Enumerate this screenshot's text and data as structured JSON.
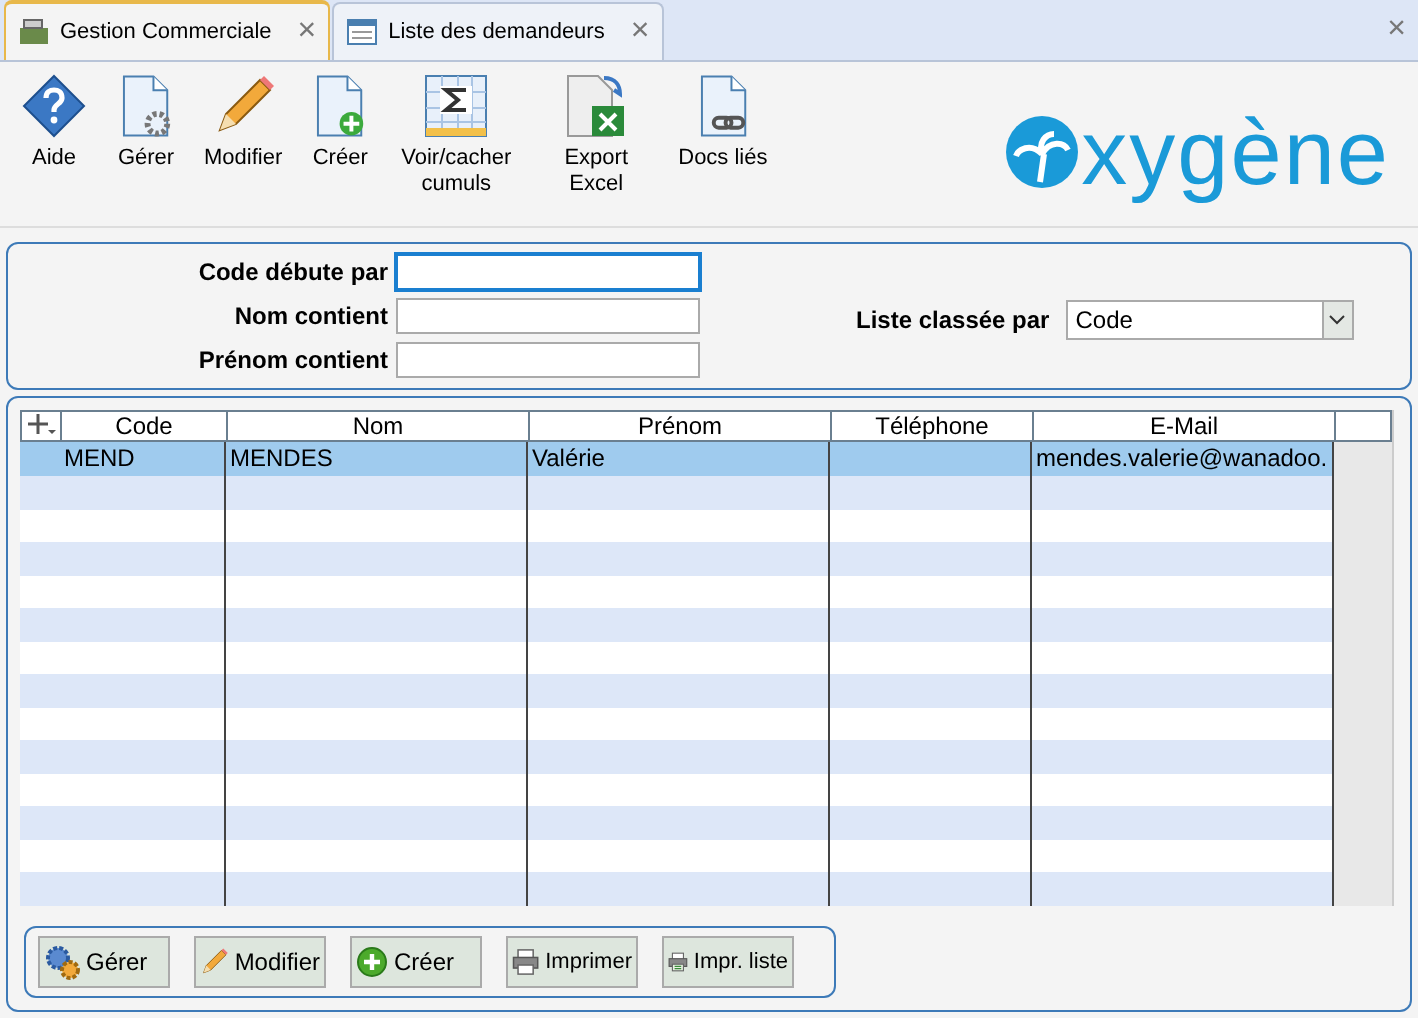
{
  "tabs": [
    {
      "label": "Gestion Commerciale",
      "selected": true,
      "close": "×"
    },
    {
      "label": "Liste des demandeurs",
      "selected": false,
      "close": "×"
    }
  ],
  "close_all": "×",
  "toolbar": [
    "Aide",
    "Gérer",
    "Modifier",
    "Créer",
    "Voir/cacher cumuls",
    "Export Excel",
    "Docs liés"
  ],
  "logo": "xygène",
  "filters": [
    {
      "label": "Code débute par",
      "focused": true
    },
    {
      "label": "Nom contient",
      "focused": false
    },
    {
      "label": "Prénom contient",
      "focused": false
    }
  ],
  "sort": {
    "label": "Liste classée par",
    "value": "Code"
  },
  "table": {
    "columns": [
      "Code",
      "Nom",
      "Prénom",
      "Téléphone",
      "E-Mail"
    ],
    "rows": [
      {
        "cells": [
          "MEND",
          "MENDES",
          "Valérie",
          "",
          "mendes.valerie@wanadoo."
        ],
        "selected": true
      }
    ]
  },
  "buttons": [
    "Gérer",
    "Modifier",
    "Créer",
    "Imprimer",
    "Impr. liste"
  ]
}
